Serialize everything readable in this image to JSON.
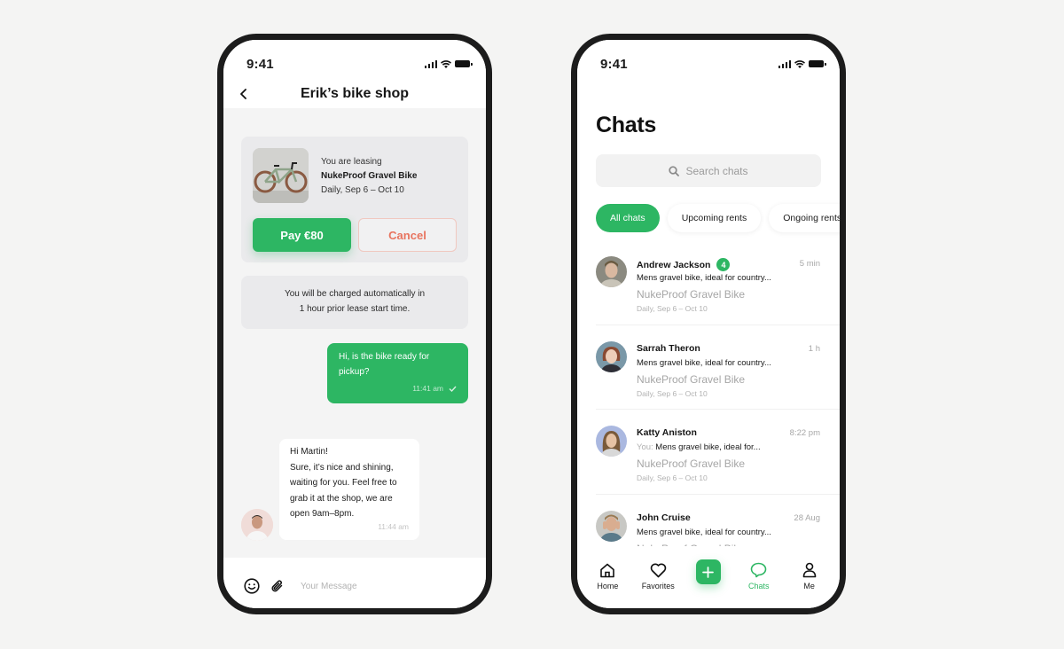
{
  "colors": {
    "accent": "#2db663",
    "cancel": "#e8745f",
    "frame": "#1c1c1c",
    "background": "#f4f4f3"
  },
  "left_phone": {
    "status": {
      "time": "9:41",
      "icons": [
        "signal-icon",
        "wifi-icon",
        "battery-icon"
      ]
    },
    "header": {
      "back_icon": "chevron-left-icon",
      "title": "Erik’s bike shop"
    },
    "lease_card": {
      "label": "You are leasing",
      "product": "NukeProof Gravel Bike",
      "dates": "Daily, Sep 6 – Oct 10",
      "pay_label": "Pay €80",
      "cancel_label": "Cancel"
    },
    "charge_note": {
      "line1": "You will be charged automatically in",
      "line2": "1 hour prior lease start time."
    },
    "messages": [
      {
        "direction": "outgoing",
        "lines": [
          "Hi, is the bike ready for",
          "pickup?"
        ],
        "time": "11:41 am",
        "status": "read-check-icon"
      },
      {
        "direction": "incoming",
        "lines": [
          "Hi Martin!",
          "Sure, it’s nice and shining,",
          "waiting for you. Feel free to",
          "grab it at the shop, we are",
          "open 9am–8pm."
        ],
        "time": "11:44 am"
      }
    ],
    "composer": {
      "placeholder": "Your Message",
      "value": "",
      "icons": [
        "emoji-icon",
        "paperclip-icon"
      ]
    }
  },
  "right_phone": {
    "status": {
      "time": "9:41"
    },
    "title": "Chats",
    "search": {
      "placeholder": "Search chats",
      "value": ""
    },
    "filters": [
      {
        "label": "All chats",
        "active": true
      },
      {
        "label": "Upcoming rents",
        "active": false
      },
      {
        "label": "Ongoing rents",
        "active": false
      }
    ],
    "chats": [
      {
        "name": "Andrew Jackson",
        "badge": "4",
        "time": "5 min",
        "prefix": "",
        "message": "Mens gravel bike, ideal for country...",
        "product": "NukeProof Gravel Bike",
        "dates": "Daily, Sep 6 – Oct 10"
      },
      {
        "name": "Sarrah Theron",
        "badge": "",
        "time": "1 h",
        "prefix": "",
        "message": "Mens gravel bike, ideal for country...",
        "product": "NukeProof Gravel Bike",
        "dates": "Daily, Sep 6 – Oct 10"
      },
      {
        "name": "Katty Aniston",
        "badge": "",
        "time": "8:22 pm",
        "prefix": "You:",
        "message": " Mens gravel bike, ideal for...",
        "product": "NukeProof Gravel Bike",
        "dates": "Daily, Sep 6 – Oct 10"
      },
      {
        "name": "John Cruise",
        "badge": "",
        "time": "28 Aug",
        "prefix": "",
        "message": "Mens gravel bike, ideal for country...",
        "product": "NukeProof Gravel Bike",
        "dates": ""
      }
    ],
    "tab_bar": [
      {
        "label": "Home",
        "icon": "home-icon",
        "active": false
      },
      {
        "label": "Favorites",
        "icon": "heart-icon",
        "active": false
      },
      {
        "label": "",
        "icon": "plus-icon",
        "active": false
      },
      {
        "label": "Chats",
        "icon": "chat-bubble-icon",
        "active": true
      },
      {
        "label": "Me",
        "icon": "user-icon",
        "active": false
      }
    ]
  }
}
